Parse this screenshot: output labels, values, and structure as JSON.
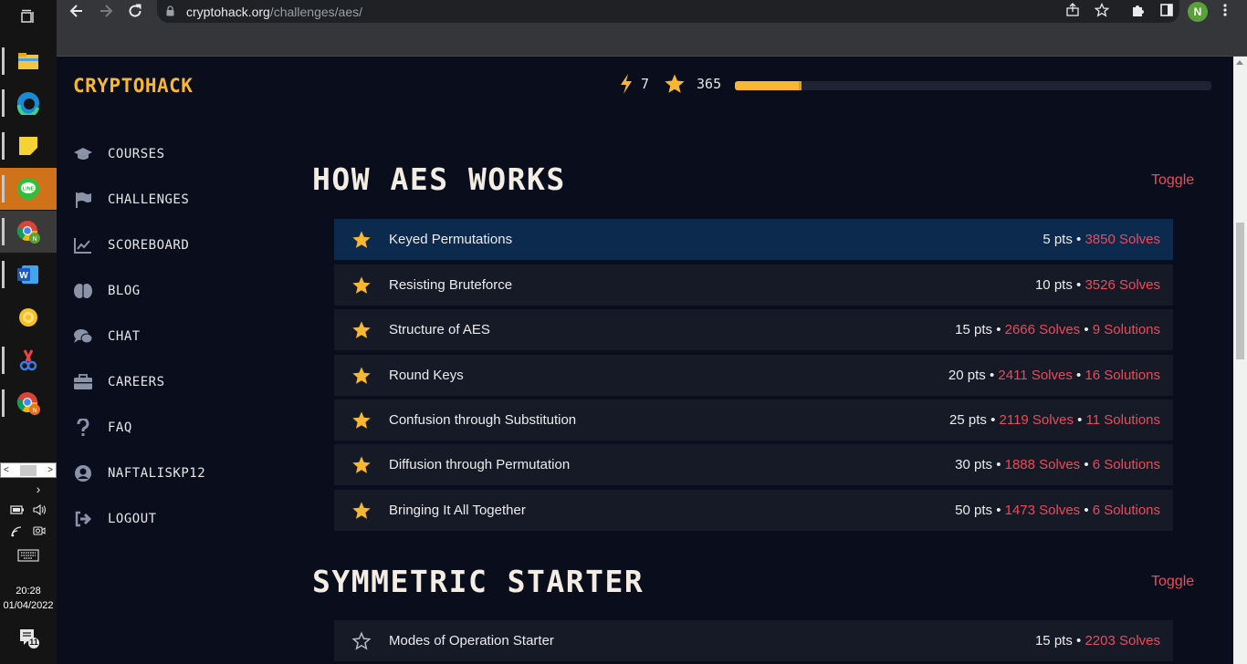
{
  "taskbar": {
    "time": "20:28",
    "date": "01/04/2022",
    "notification_count": "11",
    "apps": [
      {
        "icon": "file-explorer-icon"
      },
      {
        "icon": "edge-icon"
      },
      {
        "icon": "sticky-notes-icon"
      },
      {
        "icon": "line-icon",
        "label": "LINE"
      },
      {
        "icon": "chrome-icon"
      },
      {
        "icon": "word-icon",
        "label": "W"
      },
      {
        "icon": "settings-icon"
      },
      {
        "icon": "snipping-tool-icon"
      },
      {
        "icon": "chrome-icon"
      }
    ]
  },
  "browser": {
    "url_host": "cryptohack.org",
    "url_path": "/challenges/aes/",
    "profile_initial": "N"
  },
  "site": {
    "logo": "CRYPTOHACK",
    "bolt_count": "7",
    "star_count": "365",
    "progress_fraction": 0.14,
    "accent_color": "#f7b731",
    "link_color": "#ea4b5a"
  },
  "sidebar": {
    "items": [
      {
        "label": "COURSES",
        "icon": "graduation-cap-icon"
      },
      {
        "label": "CHALLENGES",
        "icon": "flag-icon"
      },
      {
        "label": "SCOREBOARD",
        "icon": "chart-line-icon"
      },
      {
        "label": "BLOG",
        "icon": "brain-icon"
      },
      {
        "label": "CHAT",
        "icon": "comments-icon"
      },
      {
        "label": "CAREERS",
        "icon": "briefcase-icon"
      },
      {
        "label": "FAQ",
        "icon": "question-icon"
      },
      {
        "label": "NAFTALISKP12",
        "icon": "user-circle-icon"
      },
      {
        "label": "LOGOUT",
        "icon": "sign-out-icon"
      }
    ]
  },
  "sections": [
    {
      "title": "HOW AES WORKS",
      "toggle": "Toggle",
      "challenges": [
        {
          "name": "Keyed Permutations",
          "pts": "5 pts",
          "solves": "3850 Solves",
          "solutions": "",
          "solved": true,
          "selected": true
        },
        {
          "name": "Resisting Bruteforce",
          "pts": "10 pts",
          "solves": "3526 Solves",
          "solutions": "",
          "solved": true
        },
        {
          "name": "Structure of AES",
          "pts": "15 pts",
          "solves": "2666 Solves",
          "solutions": "9 Solutions",
          "solved": true
        },
        {
          "name": "Round Keys",
          "pts": "20 pts",
          "solves": "2411 Solves",
          "solutions": "16 Solutions",
          "solved": true
        },
        {
          "name": "Confusion through Substitution",
          "pts": "25 pts",
          "solves": "2119 Solves",
          "solutions": "11 Solutions",
          "solved": true
        },
        {
          "name": "Diffusion through Permutation",
          "pts": "30 pts",
          "solves": "1888 Solves",
          "solutions": "6 Solutions",
          "solved": true
        },
        {
          "name": "Bringing It All Together",
          "pts": "50 pts",
          "solves": "1473 Solves",
          "solutions": "6 Solutions",
          "solved": true
        }
      ]
    },
    {
      "title": "SYMMETRIC STARTER",
      "toggle": "Toggle",
      "challenges": [
        {
          "name": "Modes of Operation Starter",
          "pts": "15 pts",
          "solves": "2203 Solves",
          "solutions": "",
          "solved": false
        }
      ]
    }
  ]
}
